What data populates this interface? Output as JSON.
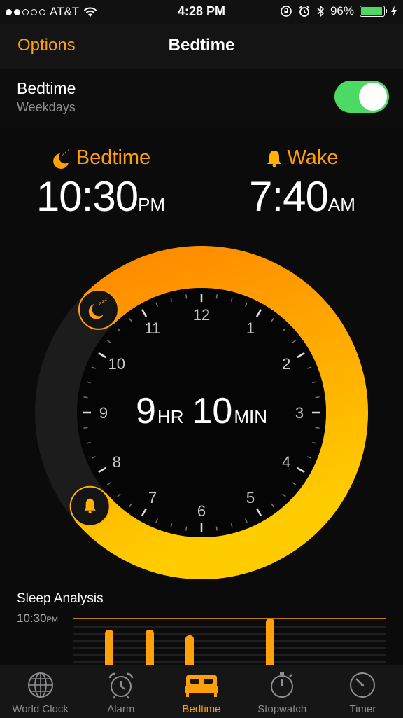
{
  "status_bar": {
    "carrier": "AT&T",
    "time": "4:28 PM",
    "battery": "96%",
    "battery_fraction": 0.96
  },
  "nav": {
    "left_label": "Options",
    "title": "Bedtime"
  },
  "toggle_row": {
    "label": "Bedtime",
    "sublabel": "Weekdays",
    "enabled": true
  },
  "bedtime": {
    "label": "Bedtime",
    "time": "10:30",
    "ampm": "PM"
  },
  "wake": {
    "label": "Wake",
    "time": "7:40",
    "ampm": "AM"
  },
  "dial": {
    "hours": [
      "12",
      "1",
      "2",
      "3",
      "4",
      "5",
      "6",
      "7",
      "8",
      "9",
      "10",
      "11"
    ],
    "duration_hours": "9",
    "hr_unit": "HR",
    "duration_minutes": "10",
    "min_unit": "MIN",
    "start_hour": 22.5,
    "end_hour": 7.6667
  },
  "sleep_analysis": {
    "title": "Sleep Analysis",
    "y_label": "10:30",
    "y_label_ampm": "PM"
  },
  "tabs": [
    {
      "label": "World Clock",
      "icon": "globe-icon",
      "active": false
    },
    {
      "label": "Alarm",
      "icon": "alarm-clock-icon",
      "active": false
    },
    {
      "label": "Bedtime",
      "icon": "bed-icon",
      "active": true
    },
    {
      "label": "Stopwatch",
      "icon": "stopwatch-icon",
      "active": false
    },
    {
      "label": "Timer",
      "icon": "timer-icon",
      "active": false
    }
  ],
  "colors": {
    "accent": "#ff9f0a",
    "switch_on": "#4cd964",
    "ring_start": "#ff8a00",
    "ring_end": "#ffcc00"
  }
}
